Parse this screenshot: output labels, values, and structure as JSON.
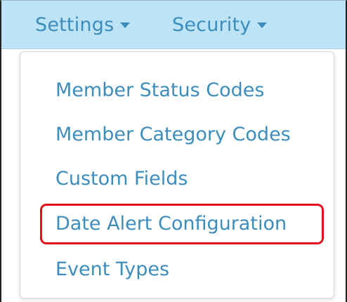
{
  "navbar": {
    "items": [
      {
        "label": "Settings"
      },
      {
        "label": "Security"
      }
    ]
  },
  "dropdown": {
    "items": [
      {
        "label": "Member Status Codes"
      },
      {
        "label": "Member Category Codes"
      },
      {
        "label": "Custom Fields"
      },
      {
        "label": "Date Alert Configuration",
        "highlighted": true
      },
      {
        "label": "Event Types"
      }
    ]
  },
  "colors": {
    "navbar_background": "#bde3f6",
    "link": "#3c8dbc",
    "highlight_border": "#e3101c"
  },
  "icons": {
    "dropdown_caret": "caret-down-icon"
  }
}
